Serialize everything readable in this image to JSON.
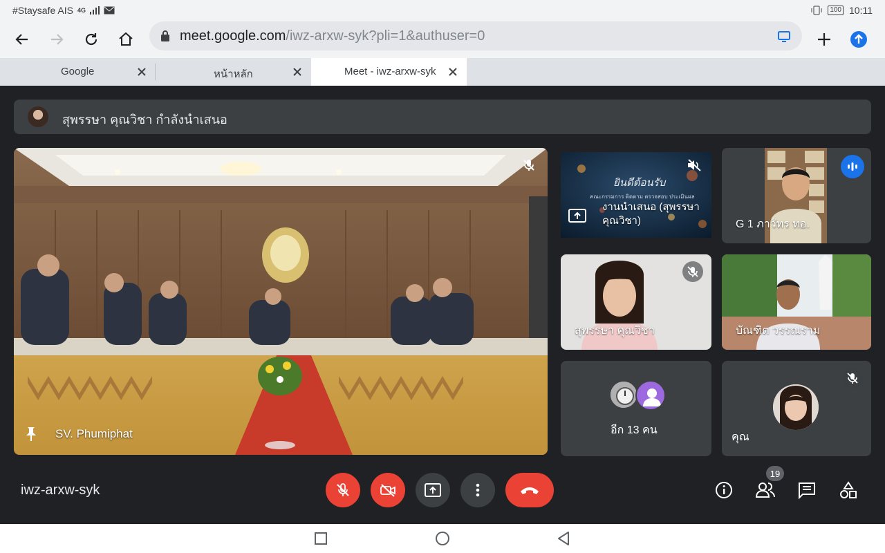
{
  "status": {
    "carrier": "#Staysafe AIS",
    "signal": "4G",
    "battery": "100",
    "time": "10:11"
  },
  "browser": {
    "url_host": "meet.google.com",
    "url_path": "/iwz-arxw-syk?pli=1&authuser=0",
    "tabs": [
      {
        "label": "Google",
        "active": false
      },
      {
        "label": "หน้าหลัก",
        "active": false
      },
      {
        "label": "Meet - iwz-arxw-syk",
        "active": true
      }
    ]
  },
  "meet": {
    "presenting_text": "สุพรรษา คุณวิชา กำลังนำเสนอ",
    "main_tile": {
      "name": "SV. Phumiphat",
      "muted": true,
      "pinned": true
    },
    "tiles": [
      {
        "name": "งานนำเสนอ (สุพรรษา คุณวิชา)",
        "slide_title": "ยินดีต้อนรับ",
        "slide_subtitle": "คณะกรรมการ ติดตาม ตรวจสอบ ประเมินผล",
        "type": "presentation",
        "muted": true
      },
      {
        "name": "G 1 ภาวัทร ทอ.",
        "speaking": true
      },
      {
        "name": "สุพรรษา คุณวิชา",
        "muted": true
      },
      {
        "name": "บัณฑิต วรรณราม"
      },
      {
        "name": "อีก 13 คน",
        "type": "others"
      },
      {
        "name": "คุณ",
        "muted": true
      }
    ],
    "meeting_code": "iwz-arxw-syk",
    "participants_count": "19",
    "colors": {
      "accent_red": "#ea4335",
      "speaking_blue": "#1a73e8",
      "bg": "#202124"
    }
  }
}
